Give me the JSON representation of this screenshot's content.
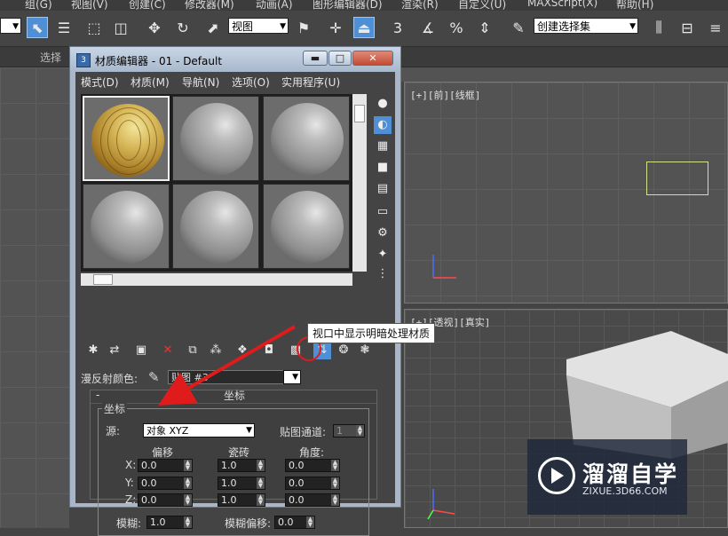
{
  "app_menu": [
    "组(G)",
    "视图(V)",
    "创建(C)",
    "修改器(M)",
    "动画(A)",
    "图形编辑器(D)",
    "渲染(R)",
    "自定义(U)",
    "MAXScript(X)",
    "帮助(H)"
  ],
  "toolbar": {
    "view_combo": "视图",
    "number_3": "3",
    "selection_set_combo": "创建选择集"
  },
  "ribbon_label": "选择",
  "viewports": {
    "front_label": "[+][前][线框]",
    "persp_label": "[+][透视][真实]"
  },
  "material_editor": {
    "title": "材质编辑器 - 01 - Default",
    "menu": [
      "模式(D)",
      "材质(M)",
      "导航(N)",
      "选项(O)",
      "实用程序(U)"
    ],
    "tooltip": "视口中显示明暗处理材质",
    "diffuse_label": "漫反射颜色:",
    "map_name": "贴图 #3",
    "rollout_minus": "-",
    "rollout_title": "坐标",
    "group_title": "坐标",
    "source_label": "源:",
    "source_value": "对象 XYZ",
    "map_channel_label": "贴图通道:",
    "map_channel_value": "1",
    "col_offset": "偏移",
    "col_tiling": "瓷砖",
    "col_angle": "角度:",
    "rows": [
      {
        "axis": "X:",
        "offset": "0.0",
        "tiling": "1.0",
        "angle": "0.0"
      },
      {
        "axis": "Y:",
        "offset": "0.0",
        "tiling": "1.0",
        "angle": "0.0"
      },
      {
        "axis": "Z:",
        "offset": "0.0",
        "tiling": "1.0",
        "angle": "0.0"
      }
    ],
    "blur_label": "模糊:",
    "blur_value": "1.0",
    "blur_offset_label": "模糊偏移:",
    "blur_offset_value": "0.0"
  },
  "watermark": {
    "title": "溜溜自学",
    "url": "ZIXUE.3D66.COM"
  },
  "colors": {
    "highlight": "#4f8fd6",
    "annotation_red": "#e01b1b"
  }
}
